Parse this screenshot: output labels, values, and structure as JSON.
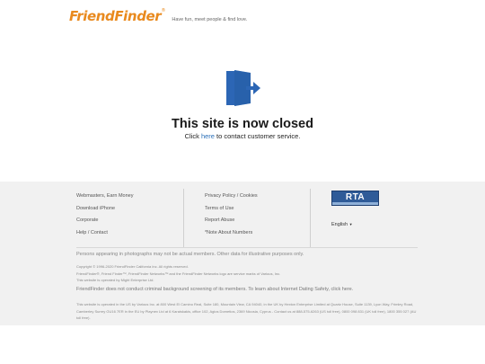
{
  "header": {
    "logo_text": "FriendFinder",
    "logo_mark": "®",
    "tagline": "Have fun, meet people & find love."
  },
  "main": {
    "icon": "exit-door-icon",
    "title": "This site is now closed",
    "subtitle_prefix": "Click ",
    "subtitle_link": "here",
    "subtitle_suffix": " to contact customer service."
  },
  "footer": {
    "links_col1": [
      "Webmasters, Earn Money",
      "Download iPhone",
      "Corporate",
      "Help / Contact"
    ],
    "links_col2": [
      "Privacy Policy / Cookies",
      "Terms of Use",
      "Report Abuse",
      "*Note About Numbers"
    ],
    "rta_label": "RTA",
    "language": "English",
    "notice": "Persons appearing in photographs may not be actual members. Other data for illustrative purposes only.",
    "copyright_lines": [
      "Copyright © 1996-2020 FriendFinder California Inc. All rights reserved.",
      "FriendFinder®, Friend Finder™, FriendFinder Networks™ and the FriendFinder Networks logo are service marks of Various, Inc.",
      "This website is operated by Might Enterprise Ltd."
    ],
    "safety_notice": "FriendFinder does not conduct criminal background screening of its members. To learn about Internet Dating Safety, click here.",
    "legal_text": "This website is operated in the US by Various Inc. at 800 West El Camino Real, Suite 180, Mountain View, CA 94040, in the UK by Hexton Enterprise Limited at Quartz House, Suite 1139, Lyon Way, Frimley Road, Camberley Surrey GU16 7ER in the EU by Playnex Ltd at 6 Karaiskakis, office 102, Agios Dometios, 2369 Nicosia, Cyprus - Contact us at 888-575-6263 (US toll free), 0800 098 831 (UK toll free), 1800 355 027 (AU toll free).",
    "colors": {
      "accent": "#e98a1e",
      "link": "#2a6fb8",
      "rta_blue": "#2f5b98",
      "footer_bg": "#f1f1f1"
    }
  }
}
